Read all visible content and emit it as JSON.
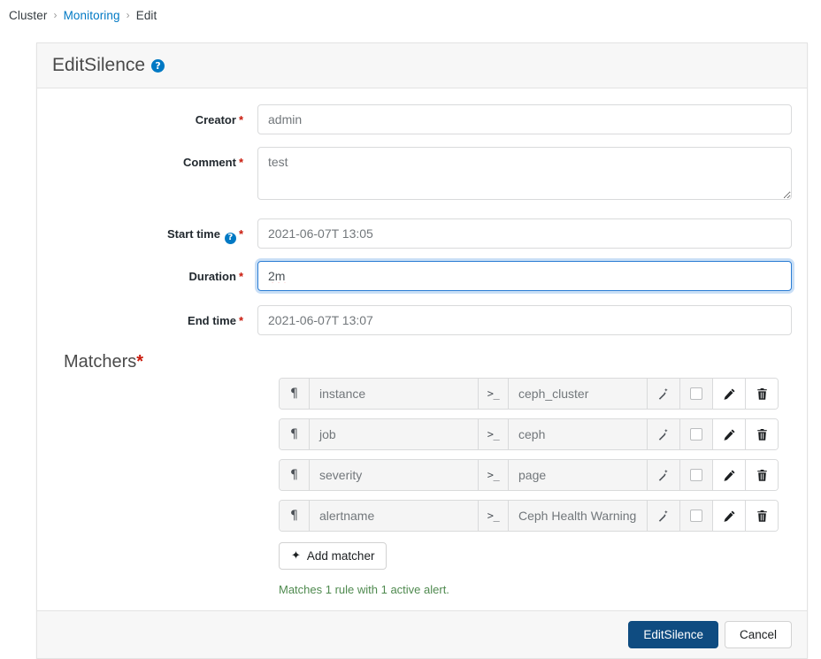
{
  "breadcrumb": {
    "items": [
      {
        "label": "Cluster",
        "link": false
      },
      {
        "label": "Monitoring",
        "link": true
      },
      {
        "label": "Edit",
        "link": false
      }
    ],
    "separator": "›"
  },
  "card": {
    "title": "EditSilence",
    "help_icon": "help-circle-icon",
    "help_glyph": "?"
  },
  "form": {
    "creator": {
      "label": "Creator",
      "required_mark": "*",
      "value": "admin",
      "placeholder": "admin"
    },
    "comment": {
      "label": "Comment",
      "required_mark": "*",
      "value": "test",
      "placeholder": "test"
    },
    "start_time": {
      "label": "Start time",
      "required_mark": "*",
      "value": "2021-06-07T 13:05",
      "has_help": true,
      "help_glyph": "?"
    },
    "duration": {
      "label": "Duration",
      "required_mark": "*",
      "value": "2m",
      "focused": true,
      "spellcheck_error": true
    },
    "end_time": {
      "label": "End time",
      "required_mark": "*",
      "value": "2021-06-07T 13:07"
    }
  },
  "matchers": {
    "title": "Matchers",
    "required_mark": "*",
    "pilcrow_glyph": "¶",
    "terminal_glyph": ">_",
    "rows": [
      {
        "name": "instance",
        "value": "ceph_cluster",
        "regex_checked": false
      },
      {
        "name": "job",
        "value": "ceph",
        "regex_checked": false
      },
      {
        "name": "severity",
        "value": "page",
        "regex_checked": false
      },
      {
        "name": "alertname",
        "value": "Ceph Health Warning",
        "regex_checked": false
      }
    ],
    "add_button": {
      "label": "Add matcher",
      "plus_glyph": "✦"
    },
    "note": "Matches 1 rule with 1 active alert."
  },
  "footer": {
    "submit_label": "EditSilence",
    "cancel_label": "Cancel"
  },
  "colors": {
    "primary": "#0f4c81",
    "link": "#0079c4",
    "required": "#c9190b",
    "success_text": "#4f8a4f",
    "help_badge": "#0079c4",
    "focus_border": "#2b7dd4"
  }
}
